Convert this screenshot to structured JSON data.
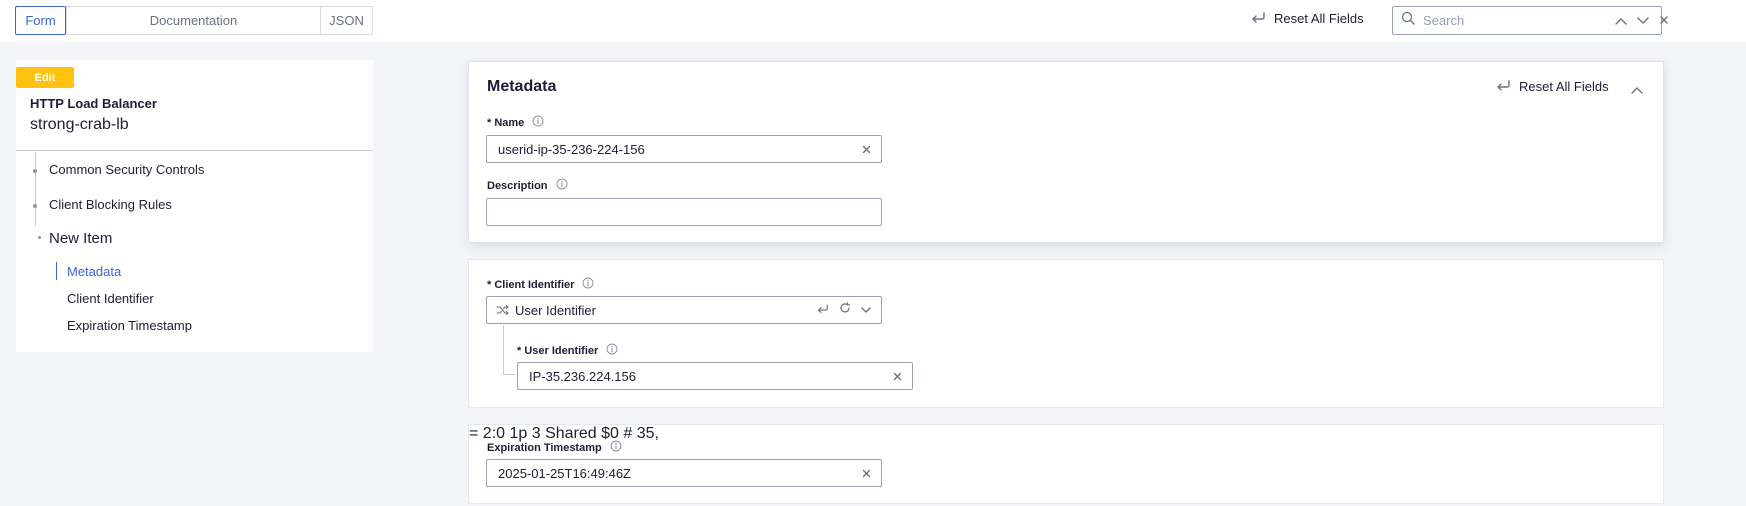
{
  "topbar": {
    "tabs": [
      {
        "label": "Form",
        "active": true
      },
      {
        "label": "Documentation",
        "active": false
      },
      {
        "label": "JSON",
        "active": false
      }
    ],
    "reset_label": "Reset All Fields",
    "search_placeholder": "Search"
  },
  "sidebar": {
    "badge": "Edit",
    "object_type": "HTTP Load Balancer",
    "object_name": "strong-crab-lb",
    "tree": [
      {
        "label": "Common Security Controls"
      },
      {
        "label": "Client Blocking Rules"
      },
      {
        "label": "New Item"
      }
    ],
    "sub_items": [
      {
        "label": "Metadata",
        "active": true
      },
      {
        "label": "Client Identifier",
        "active": false
      },
      {
        "label": "Expiration Timestamp",
        "active": false
      }
    ]
  },
  "metadata": {
    "title": "Metadata",
    "reset_label": "Reset All Fields",
    "name_label": "* Name",
    "name_value": "userid-ip-35-236-224-156",
    "description_label": "Description",
    "description_value": ""
  },
  "client_identifier": {
    "label": "* Client Identifier",
    "selected": "User Identifier",
    "user_identifier_label": "* User Identifier",
    "user_identifier_value": "IP-35.236.224.156"
  },
  "expiration": {
    "label": "Expiration Timestamp",
    "value": "2025-01-25T16:49:46Z"
  },
  "colors": {
    "accent": "#3b63d6",
    "badge": "#ffc20e",
    "background": "#f4f5f8"
  }
}
